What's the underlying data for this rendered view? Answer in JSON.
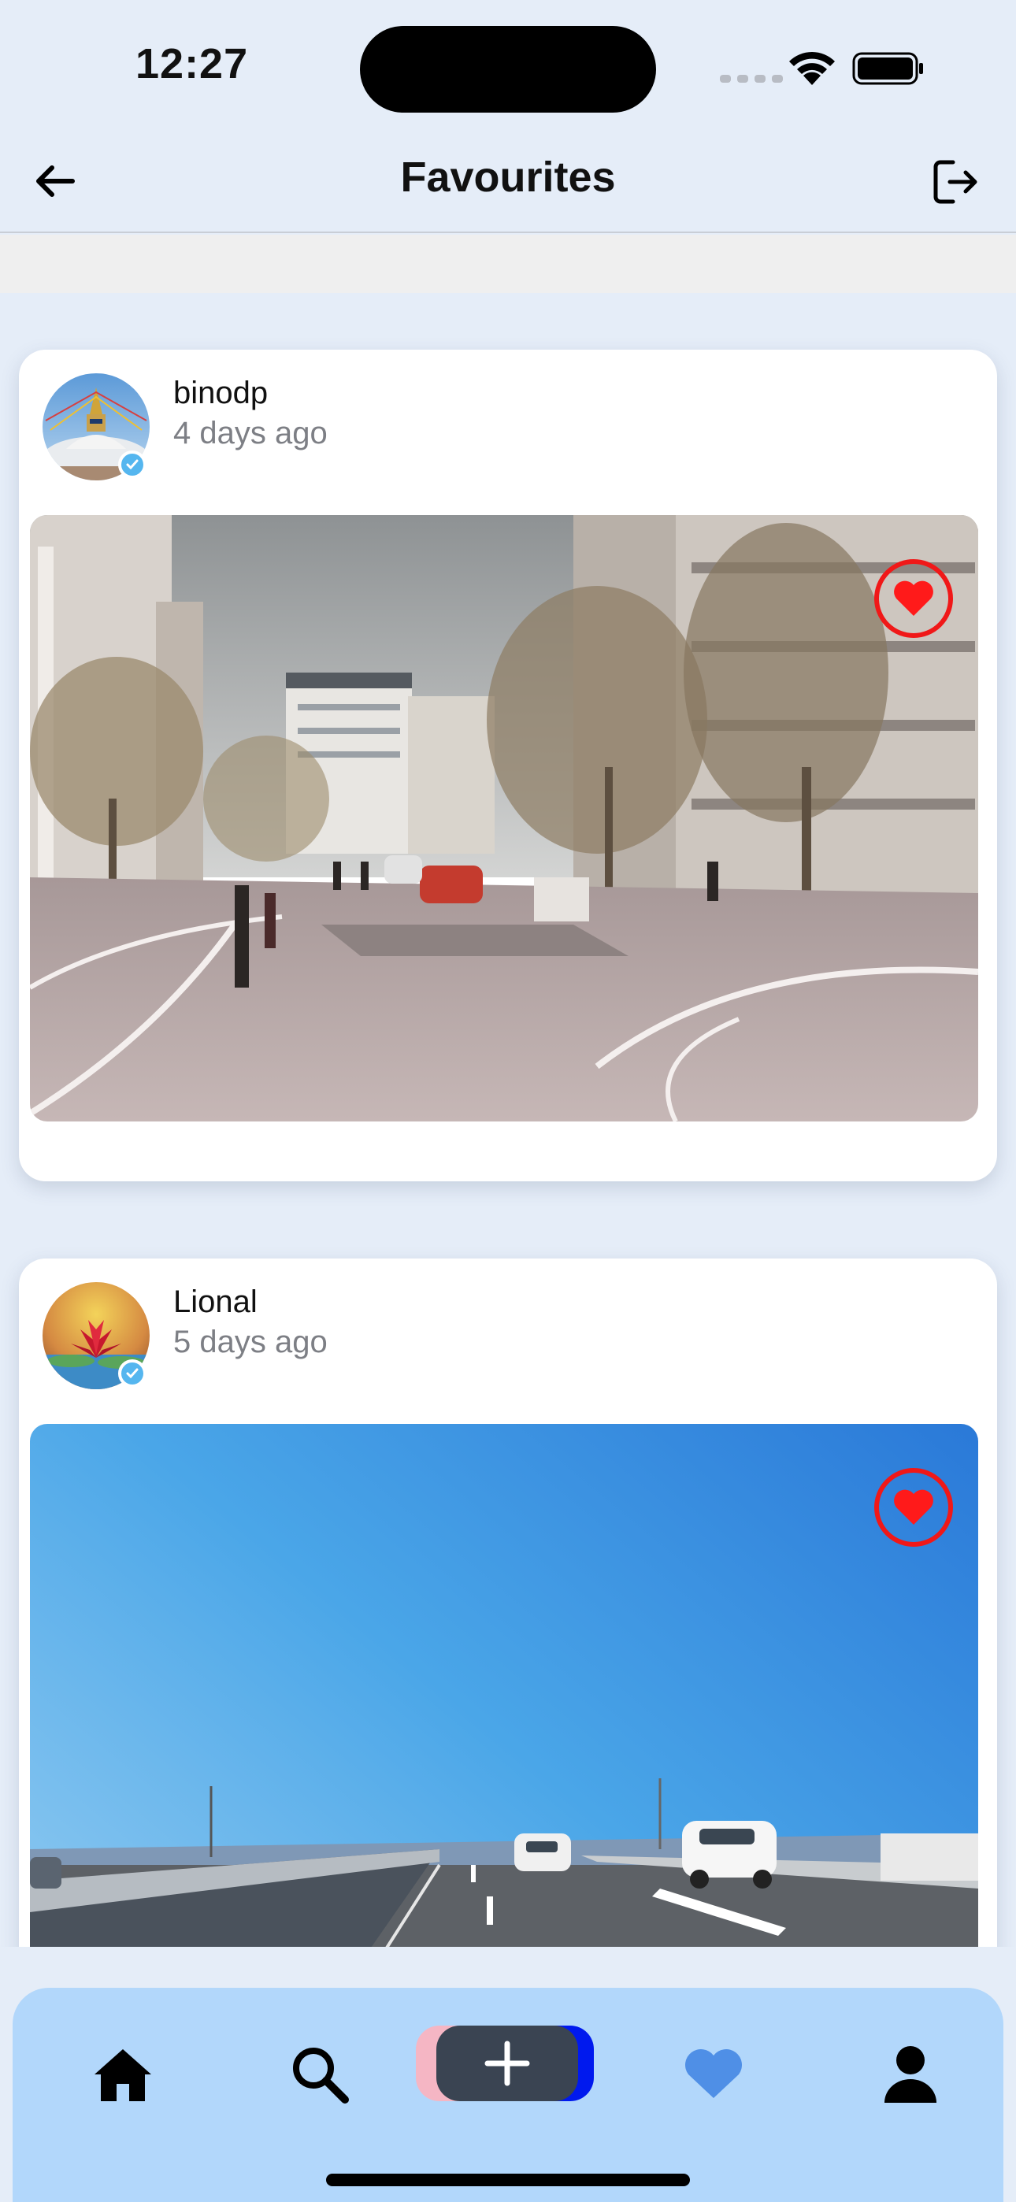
{
  "status_bar": {
    "time": "12:27"
  },
  "header": {
    "title": "Favourites"
  },
  "posts": [
    {
      "username": "binodp",
      "time_ago": "4 days ago",
      "favorited": true,
      "avatar_icon": "stupa-avatar-image",
      "media_description": "street-scene-image"
    },
    {
      "username": "Lional",
      "time_ago": "5 days ago",
      "favorited": true,
      "avatar_icon": "lotus-avatar-image",
      "media_description": "highway-scene-image"
    }
  ],
  "tab_bar": {
    "items": [
      "home-icon",
      "search-icon",
      "create-plus-icon",
      "heart-icon",
      "profile-icon"
    ],
    "active": "heart-icon"
  },
  "colors": {
    "accent_heart": "#ff1a1a",
    "tab_bar_bg": "#b2d7fb",
    "active_tab": "#4f8fe6",
    "page_bg": "#e5edf8"
  }
}
